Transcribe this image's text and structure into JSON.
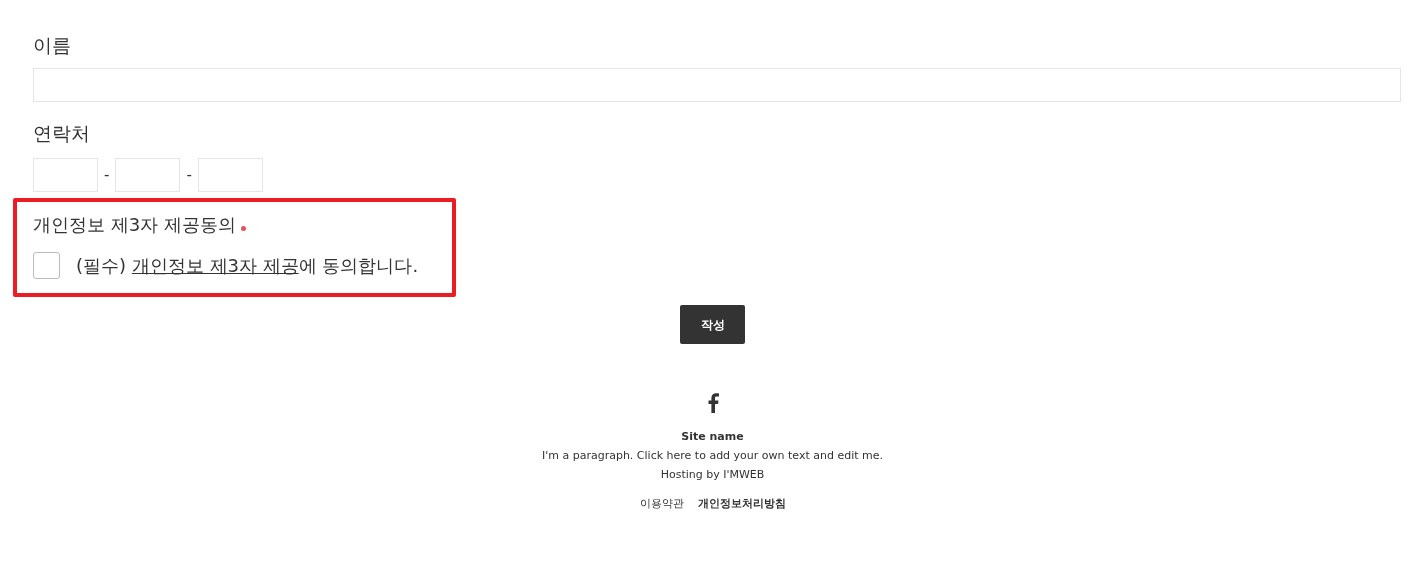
{
  "form": {
    "name_label": "이름",
    "contact_label": "연락처",
    "phone_separators": [
      "-",
      "-"
    ],
    "consent": {
      "title": "개인정보 제3자 제공동의",
      "required": true,
      "checked": false,
      "prefix": "(필수) ",
      "link": "개인정보 제3자 제공",
      "suffix": "에 동의합니다."
    },
    "submit": "작성"
  },
  "footer": {
    "site_name": "Site name",
    "paragraph": "I'm a paragraph. Click here to add your own text and edit me.",
    "hosting": "Hosting by I'MWEB",
    "links": [
      {
        "label": "이용약관",
        "bold": false
      },
      {
        "label": "개인정보처리방침",
        "bold": true
      }
    ]
  }
}
